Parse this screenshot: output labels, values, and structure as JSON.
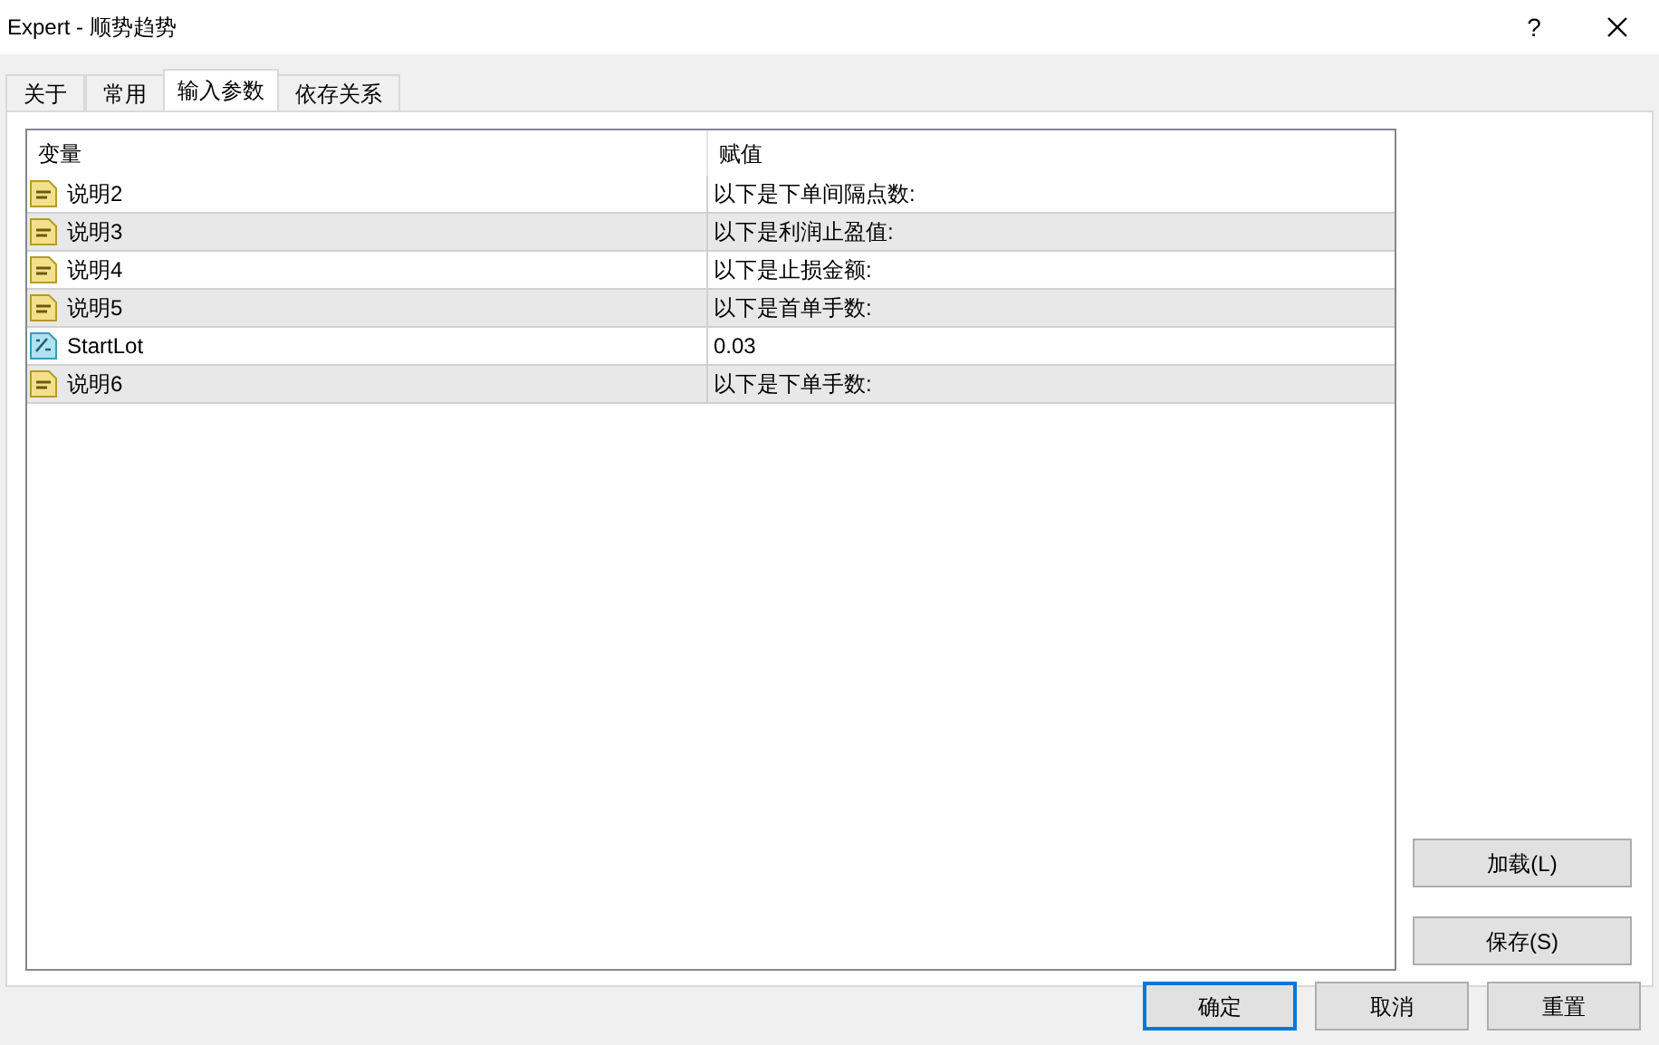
{
  "window": {
    "title": "Expert - 顺势趋势",
    "help": "?"
  },
  "tabs": [
    {
      "label": "关于",
      "selected": false
    },
    {
      "label": "常用",
      "selected": false
    },
    {
      "label": "输入参数",
      "selected": true
    },
    {
      "label": "依存关系",
      "selected": false
    }
  ],
  "table": {
    "columns": [
      "变量",
      "赋值"
    ],
    "rows": [
      {
        "kind": "text",
        "name": "说明2",
        "value": "以下是下单间隔点数:"
      },
      {
        "kind": "text",
        "name": "说明3",
        "value": "以下是利润止盈值:"
      },
      {
        "kind": "text",
        "name": "说明4",
        "value": "以下是止损金额:"
      },
      {
        "kind": "text",
        "name": "说明5",
        "value": "以下是首单手数:"
      },
      {
        "kind": "number",
        "name": "StartLot",
        "value": "0.03"
      },
      {
        "kind": "text",
        "name": "说明6",
        "value": "以下是下单手数:"
      }
    ]
  },
  "side_buttons": [
    "加载(L)",
    "保存(S)"
  ],
  "buttons": [
    {
      "label": "确定",
      "selected": true
    },
    {
      "label": "取消",
      "selected": false
    },
    {
      "label": "重置",
      "selected": false
    }
  ]
}
